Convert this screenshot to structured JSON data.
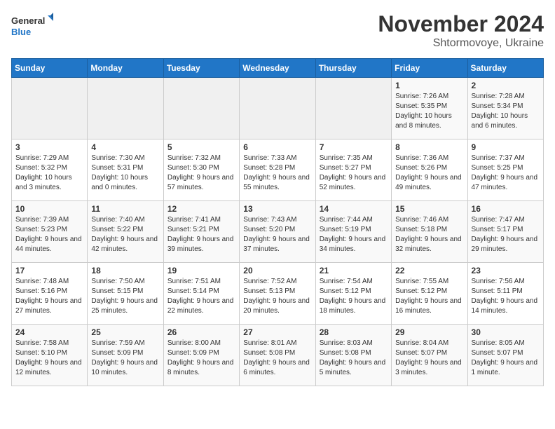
{
  "logo": {
    "text_general": "General",
    "text_blue": "Blue"
  },
  "header": {
    "month": "November 2024",
    "location": "Shtormovoye, Ukraine"
  },
  "weekdays": [
    "Sunday",
    "Monday",
    "Tuesday",
    "Wednesday",
    "Thursday",
    "Friday",
    "Saturday"
  ],
  "weeks": [
    [
      {
        "day": "",
        "empty": true
      },
      {
        "day": "",
        "empty": true
      },
      {
        "day": "",
        "empty": true
      },
      {
        "day": "",
        "empty": true
      },
      {
        "day": "",
        "empty": true
      },
      {
        "day": "1",
        "sunrise": "Sunrise: 7:26 AM",
        "sunset": "Sunset: 5:35 PM",
        "daylight": "Daylight: 10 hours and 8 minutes."
      },
      {
        "day": "2",
        "sunrise": "Sunrise: 7:28 AM",
        "sunset": "Sunset: 5:34 PM",
        "daylight": "Daylight: 10 hours and 6 minutes."
      }
    ],
    [
      {
        "day": "3",
        "sunrise": "Sunrise: 7:29 AM",
        "sunset": "Sunset: 5:32 PM",
        "daylight": "Daylight: 10 hours and 3 minutes."
      },
      {
        "day": "4",
        "sunrise": "Sunrise: 7:30 AM",
        "sunset": "Sunset: 5:31 PM",
        "daylight": "Daylight: 10 hours and 0 minutes."
      },
      {
        "day": "5",
        "sunrise": "Sunrise: 7:32 AM",
        "sunset": "Sunset: 5:30 PM",
        "daylight": "Daylight: 9 hours and 57 minutes."
      },
      {
        "day": "6",
        "sunrise": "Sunrise: 7:33 AM",
        "sunset": "Sunset: 5:28 PM",
        "daylight": "Daylight: 9 hours and 55 minutes."
      },
      {
        "day": "7",
        "sunrise": "Sunrise: 7:35 AM",
        "sunset": "Sunset: 5:27 PM",
        "daylight": "Daylight: 9 hours and 52 minutes."
      },
      {
        "day": "8",
        "sunrise": "Sunrise: 7:36 AM",
        "sunset": "Sunset: 5:26 PM",
        "daylight": "Daylight: 9 hours and 49 minutes."
      },
      {
        "day": "9",
        "sunrise": "Sunrise: 7:37 AM",
        "sunset": "Sunset: 5:25 PM",
        "daylight": "Daylight: 9 hours and 47 minutes."
      }
    ],
    [
      {
        "day": "10",
        "sunrise": "Sunrise: 7:39 AM",
        "sunset": "Sunset: 5:23 PM",
        "daylight": "Daylight: 9 hours and 44 minutes."
      },
      {
        "day": "11",
        "sunrise": "Sunrise: 7:40 AM",
        "sunset": "Sunset: 5:22 PM",
        "daylight": "Daylight: 9 hours and 42 minutes."
      },
      {
        "day": "12",
        "sunrise": "Sunrise: 7:41 AM",
        "sunset": "Sunset: 5:21 PM",
        "daylight": "Daylight: 9 hours and 39 minutes."
      },
      {
        "day": "13",
        "sunrise": "Sunrise: 7:43 AM",
        "sunset": "Sunset: 5:20 PM",
        "daylight": "Daylight: 9 hours and 37 minutes."
      },
      {
        "day": "14",
        "sunrise": "Sunrise: 7:44 AM",
        "sunset": "Sunset: 5:19 PM",
        "daylight": "Daylight: 9 hours and 34 minutes."
      },
      {
        "day": "15",
        "sunrise": "Sunrise: 7:46 AM",
        "sunset": "Sunset: 5:18 PM",
        "daylight": "Daylight: 9 hours and 32 minutes."
      },
      {
        "day": "16",
        "sunrise": "Sunrise: 7:47 AM",
        "sunset": "Sunset: 5:17 PM",
        "daylight": "Daylight: 9 hours and 29 minutes."
      }
    ],
    [
      {
        "day": "17",
        "sunrise": "Sunrise: 7:48 AM",
        "sunset": "Sunset: 5:16 PM",
        "daylight": "Daylight: 9 hours and 27 minutes."
      },
      {
        "day": "18",
        "sunrise": "Sunrise: 7:50 AM",
        "sunset": "Sunset: 5:15 PM",
        "daylight": "Daylight: 9 hours and 25 minutes."
      },
      {
        "day": "19",
        "sunrise": "Sunrise: 7:51 AM",
        "sunset": "Sunset: 5:14 PM",
        "daylight": "Daylight: 9 hours and 22 minutes."
      },
      {
        "day": "20",
        "sunrise": "Sunrise: 7:52 AM",
        "sunset": "Sunset: 5:13 PM",
        "daylight": "Daylight: 9 hours and 20 minutes."
      },
      {
        "day": "21",
        "sunrise": "Sunrise: 7:54 AM",
        "sunset": "Sunset: 5:12 PM",
        "daylight": "Daylight: 9 hours and 18 minutes."
      },
      {
        "day": "22",
        "sunrise": "Sunrise: 7:55 AM",
        "sunset": "Sunset: 5:12 PM",
        "daylight": "Daylight: 9 hours and 16 minutes."
      },
      {
        "day": "23",
        "sunrise": "Sunrise: 7:56 AM",
        "sunset": "Sunset: 5:11 PM",
        "daylight": "Daylight: 9 hours and 14 minutes."
      }
    ],
    [
      {
        "day": "24",
        "sunrise": "Sunrise: 7:58 AM",
        "sunset": "Sunset: 5:10 PM",
        "daylight": "Daylight: 9 hours and 12 minutes."
      },
      {
        "day": "25",
        "sunrise": "Sunrise: 7:59 AM",
        "sunset": "Sunset: 5:09 PM",
        "daylight": "Daylight: 9 hours and 10 minutes."
      },
      {
        "day": "26",
        "sunrise": "Sunrise: 8:00 AM",
        "sunset": "Sunset: 5:09 PM",
        "daylight": "Daylight: 9 hours and 8 minutes."
      },
      {
        "day": "27",
        "sunrise": "Sunrise: 8:01 AM",
        "sunset": "Sunset: 5:08 PM",
        "daylight": "Daylight: 9 hours and 6 minutes."
      },
      {
        "day": "28",
        "sunrise": "Sunrise: 8:03 AM",
        "sunset": "Sunset: 5:08 PM",
        "daylight": "Daylight: 9 hours and 5 minutes."
      },
      {
        "day": "29",
        "sunrise": "Sunrise: 8:04 AM",
        "sunset": "Sunset: 5:07 PM",
        "daylight": "Daylight: 9 hours and 3 minutes."
      },
      {
        "day": "30",
        "sunrise": "Sunrise: 8:05 AM",
        "sunset": "Sunset: 5:07 PM",
        "daylight": "Daylight: 9 hours and 1 minute."
      }
    ]
  ]
}
